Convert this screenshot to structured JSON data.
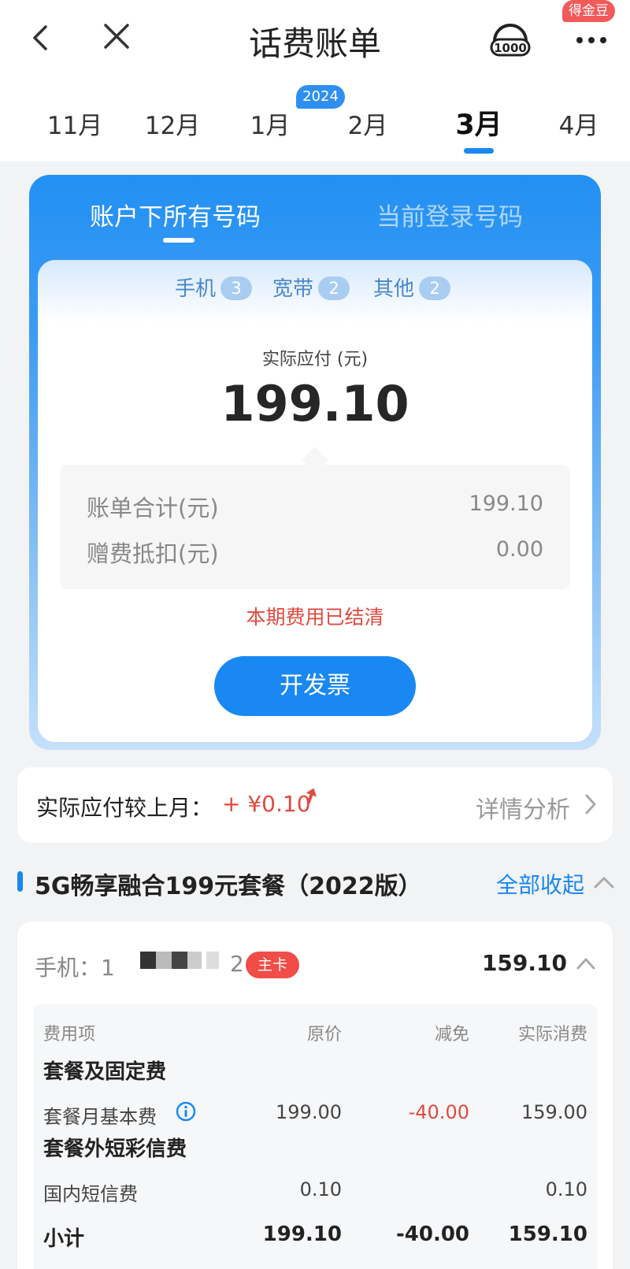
{
  "header": {
    "title": "话费账单",
    "coin_badge": "得金豆",
    "service_icon": "10000-service-icon",
    "more_icon": "more-dots-icon"
  },
  "months": {
    "items": [
      "11月",
      "12月",
      "1月",
      "2月",
      "3月",
      "4月"
    ],
    "active": "3月",
    "year_badge": "2024"
  },
  "account_tabs": {
    "all": "账户下所有号码",
    "current": "当前登录号码"
  },
  "categories": [
    {
      "label": "手机",
      "count": "3"
    },
    {
      "label": "宽带",
      "count": "2"
    },
    {
      "label": "其他",
      "count": "2"
    }
  ],
  "payment": {
    "label": "实际应付 (元)",
    "amount": "199.10",
    "bill_total_label": "账单合计(元)",
    "bill_total_value": "199.10",
    "gift_deduct_label": "赠费抵扣(元)",
    "gift_deduct_value": "0.00",
    "status": "本期费用已结清",
    "invoice_button": "开发票"
  },
  "compare": {
    "label": "实际应付较上月：",
    "value": "+ ¥0.10",
    "detail_link": "详情分析"
  },
  "plan": {
    "title": "5G畅享融合199元套餐（2022版）",
    "collapse_link": "全部收起"
  },
  "phone": {
    "label": "手机：",
    "number_start": "1 ",
    "number_end": "2",
    "badge": "主卡",
    "total": "159.10"
  },
  "table": {
    "headers": [
      "费用项",
      "原价",
      "减免",
      "实际消费"
    ],
    "group1": "套餐及固定费",
    "row1": [
      "套餐月基本费",
      "199.00",
      "-40.00",
      "159.00"
    ],
    "group2": "套餐外短彩信费",
    "row2": [
      "国内短信费",
      "0.10",
      "",
      "0.10"
    ],
    "subtotal": [
      "小计",
      "199.10",
      "-40.00",
      "159.10"
    ]
  },
  "colors": {
    "accent": "#1a88f2",
    "alert": "#e04a3f",
    "badge_red": "#f04d48"
  }
}
